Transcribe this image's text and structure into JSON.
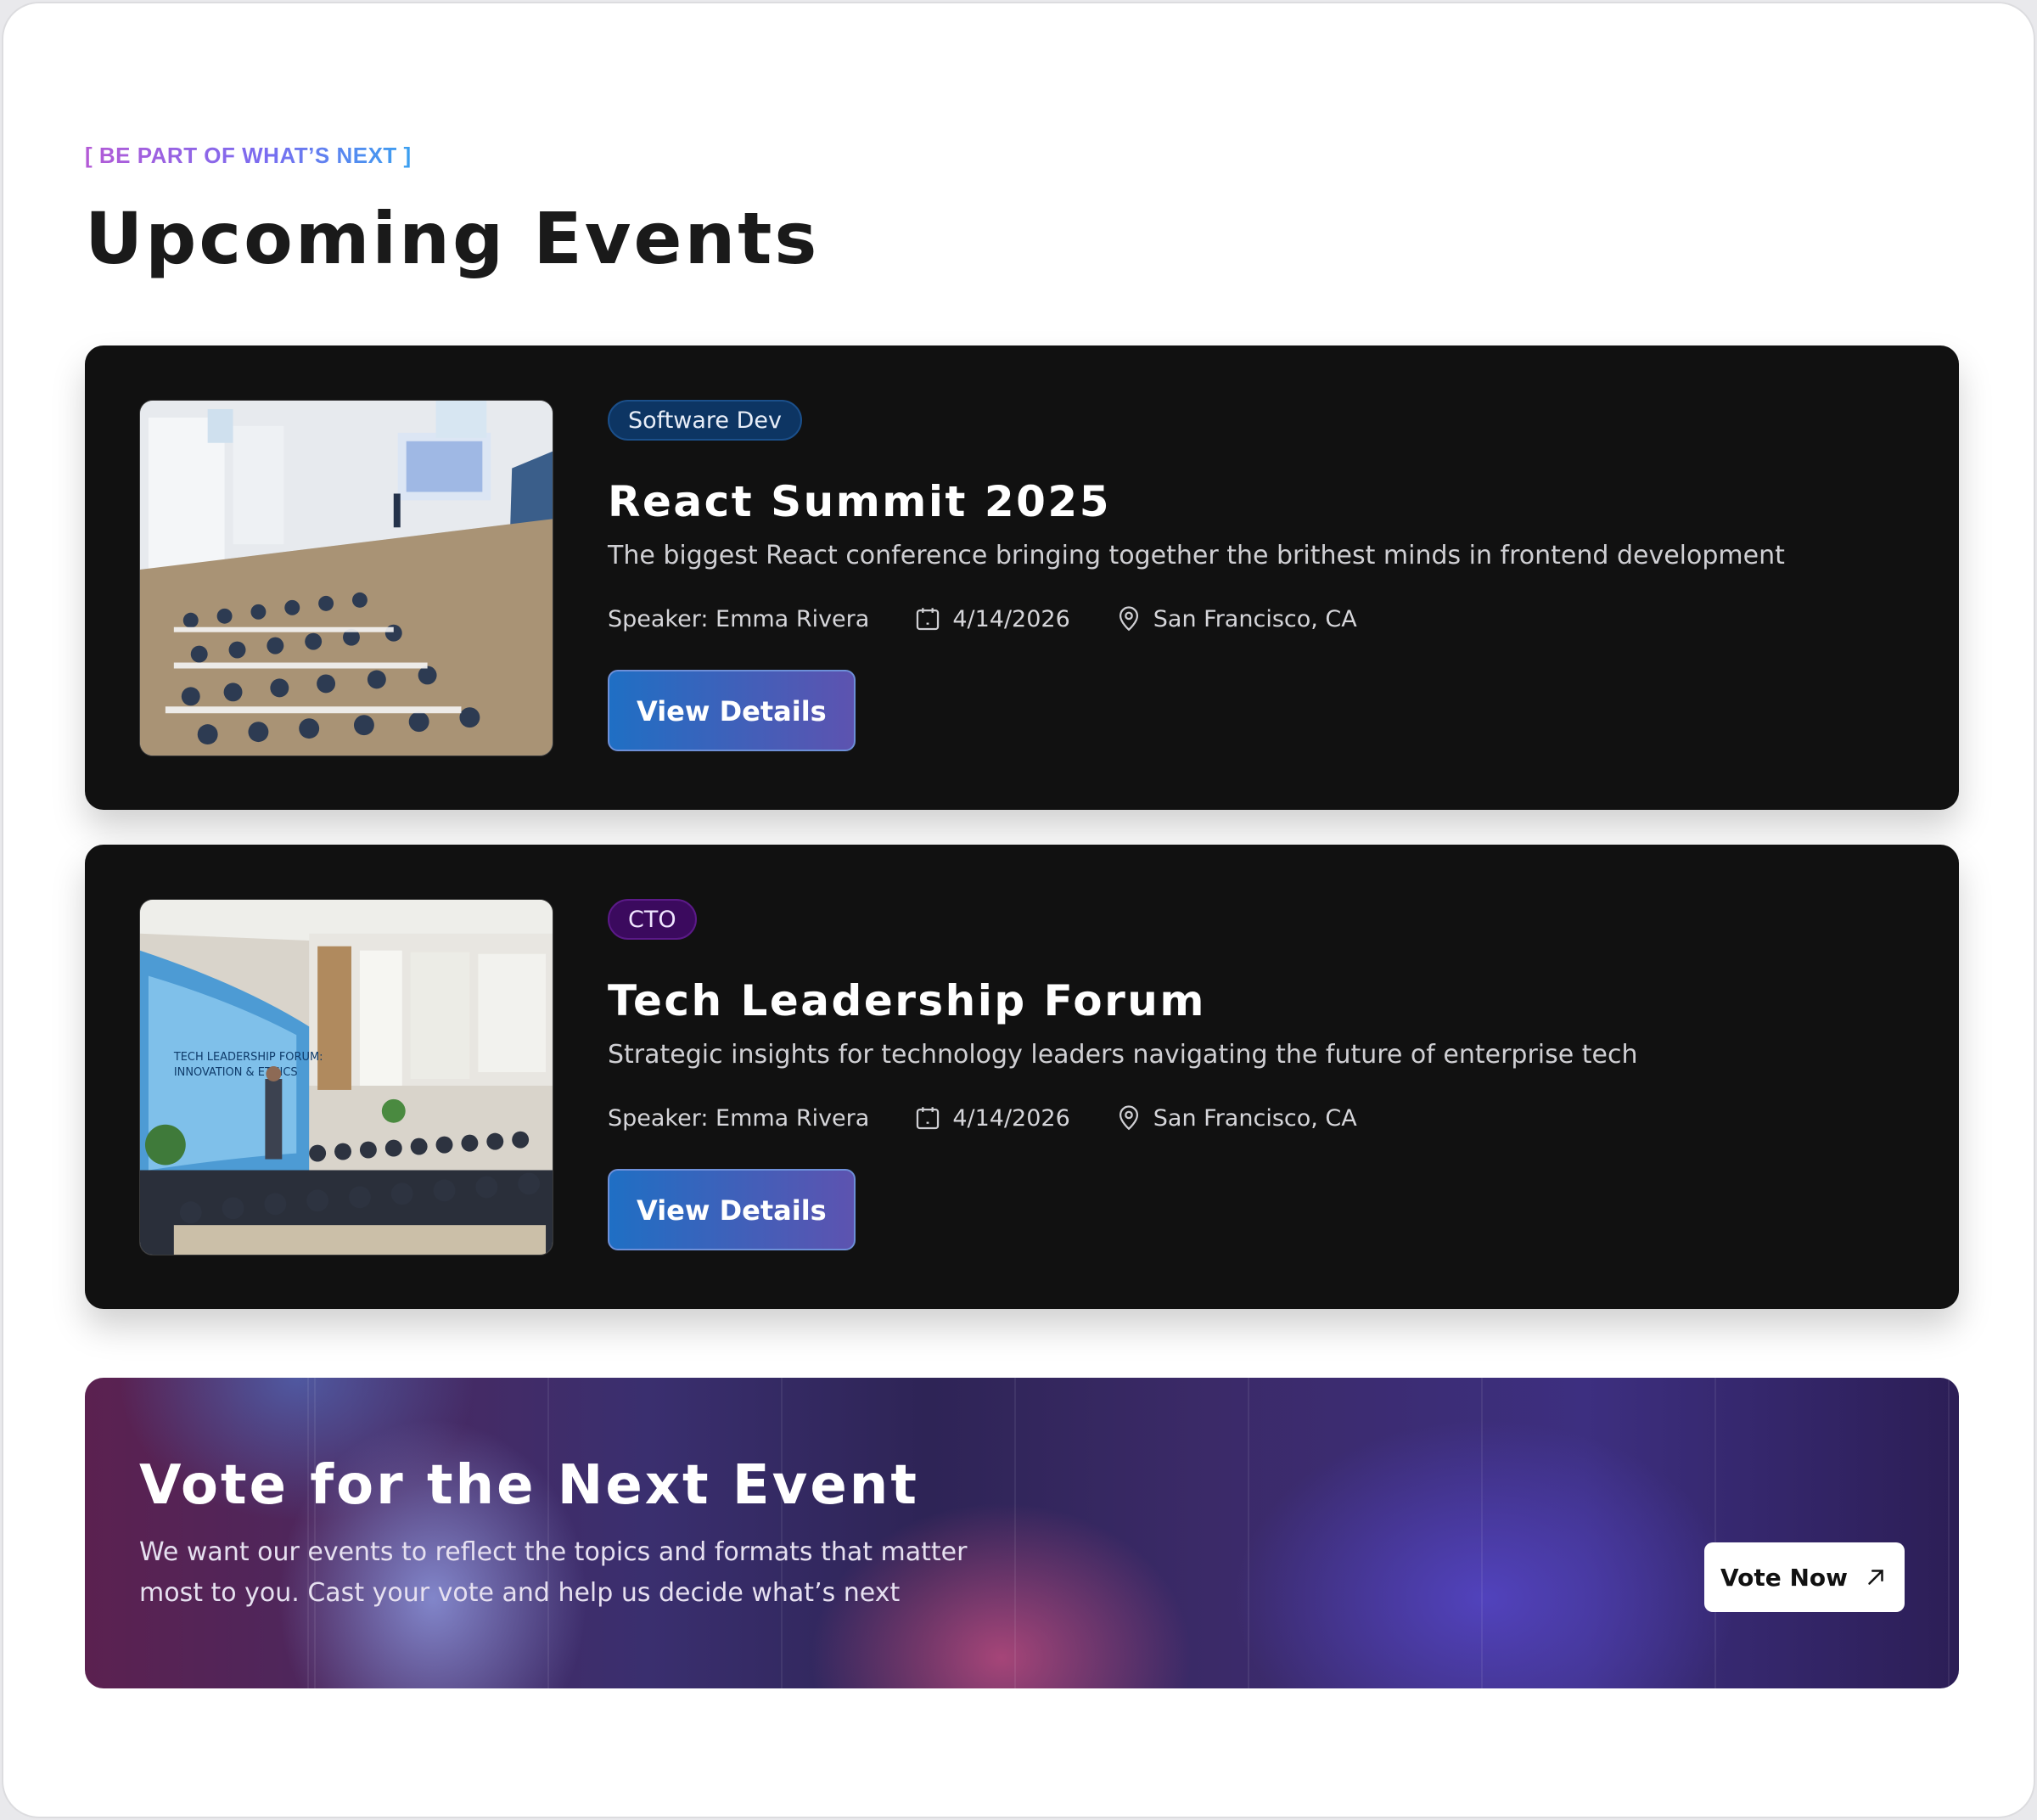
{
  "header": {
    "eyebrow": "[ BE PART OF WHAT’S NEXT ]",
    "title": "Upcoming Events"
  },
  "events": [
    {
      "tag": "Software Dev",
      "title": "React Summit 2025",
      "description": "The biggest React conference bringing together the brithest minds in frontend development",
      "speaker": "Speaker: Emma Rivera",
      "date": "4/14/2026",
      "location": "San Francisco, CA",
      "button": "View Details",
      "image": "conference-classroom-photo"
    },
    {
      "tag": "CTO",
      "title": "Tech Leadership Forum",
      "description": "Strategic insights for technology leaders navigating the future of enterprise tech",
      "speaker": "Speaker: Emma Rivera",
      "date": "4/14/2026",
      "location": "San Francisco, CA",
      "button": "View Details",
      "image": "forum-auditorium-photo"
    }
  ],
  "vote": {
    "title": "Vote for the Next Event",
    "text_line1": "We want our events to reflect the topics and formats that matter",
    "text_line2": "most to you. Cast your vote and help us decide what’s next",
    "button": "Vote Now",
    "button_icon": "arrow-up-right-icon"
  },
  "colors": {
    "card_bg": "#111111",
    "tag_blue": "#0d3563",
    "tag_purple": "#3b0a5e",
    "button_gradient_start": "#1f6fc4",
    "button_gradient_end": "#5d53b0"
  }
}
